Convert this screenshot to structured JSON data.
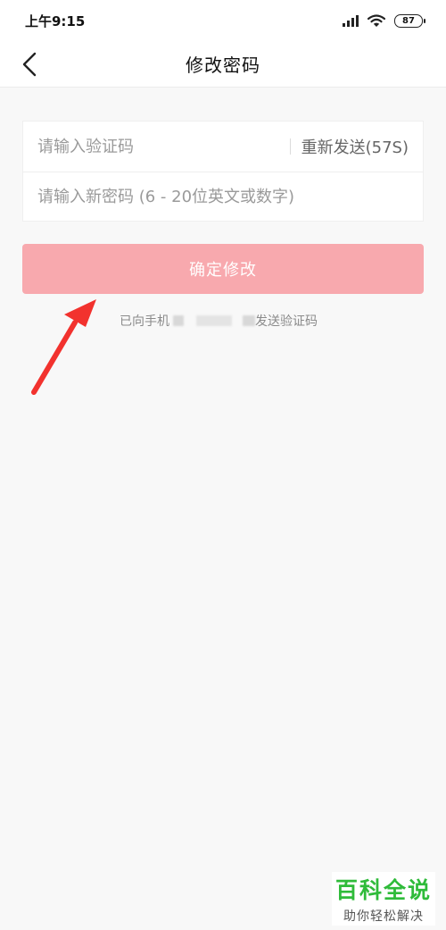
{
  "status_bar": {
    "time": "上午9:15",
    "battery": "87",
    "icons": [
      "signal-icon",
      "wifi-icon",
      "battery-icon"
    ]
  },
  "nav": {
    "title": "修改密码",
    "back_icon": "back-arrow-icon"
  },
  "form": {
    "code_placeholder": "请输入验证码",
    "code_value": "",
    "resend_label": "重新发送(57S)",
    "password_placeholder": "请输入新密码 (6 - 20位英文或数字)",
    "password_value": ""
  },
  "confirm_button": {
    "label": "确定修改",
    "color": "#f8a9ae"
  },
  "sent_tip": {
    "prefix": "已向手机",
    "suffix": "发送验证码"
  },
  "annotation": {
    "icon": "red-arrow-icon",
    "color": "#f2322e"
  },
  "watermark": {
    "title": "百科全说",
    "subtitle": "助你轻松解决",
    "color": "#2fbb3a"
  }
}
